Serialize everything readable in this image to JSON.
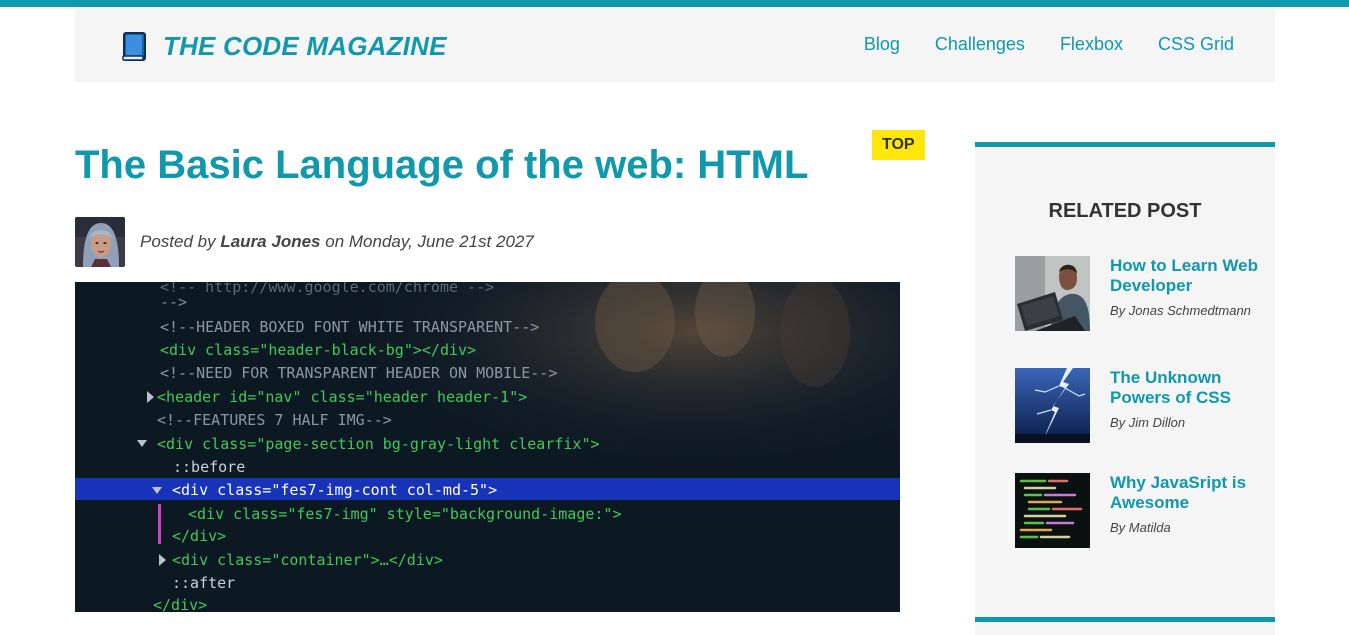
{
  "header": {
    "brand_icon": "blue-book-icon",
    "title": "THE CODE MAGAZINE",
    "nav": [
      {
        "label": "Blog"
      },
      {
        "label": "Challenges"
      },
      {
        "label": "Flexbox"
      },
      {
        "label": "CSS Grid"
      }
    ]
  },
  "post": {
    "tag": "TOP",
    "title": "The Basic Language of the web: HTML",
    "meta": {
      "prefix": "Posted by",
      "author": "Laura Jones",
      "on": "on",
      "date": "Monday, June 21st 2027"
    }
  },
  "sidebar": {
    "heading": "RELATED POST",
    "posts": [
      {
        "title": "How to Learn Web Developer",
        "by": "By Jonas Schmedtmann"
      },
      {
        "title": "The Unknown Powers of CSS",
        "by": "By Jim Dillon"
      },
      {
        "title": "Why JavaSript is Awesome",
        "by": "By Matilda"
      }
    ]
  },
  "code_lines": [
    "<!-- http://www.google.com/chrome -->",
    "-->",
    "<!--HEADER BOXED FONT WHITE TRANSPARENT-->",
    "<div class=\"header-black-bg\"></div>",
    "<!--NEED FOR TRANSPARENT HEADER ON MOBILE-->",
    "<header id=\"nav\" class=\"header header-1\">",
    "<!--FEATURES 7 HALF IMG-->",
    "<div class=\"page-section bg-gray-light clearfix\">",
    "::before",
    "<div class=\"fes7-img-cont col-md-5\">",
    "<div class=\"fes7-img\" style=\"background-image:\">",
    "</div>",
    "<div class=\"container\">…</div>",
    "::after",
    "</div>"
  ]
}
